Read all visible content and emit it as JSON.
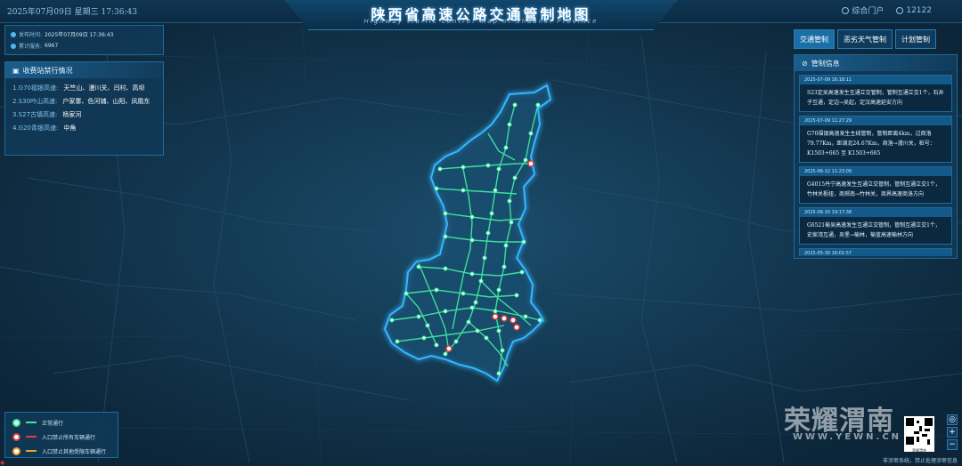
{
  "header": {
    "date": "2025年07月09日 星期三   17:36:43",
    "title": "陕西省高速公路交通管制地图",
    "subtitle": "Highway traffic control map of Shaanxi Province",
    "portal": "综合门户",
    "hotline": "12122"
  },
  "info": {
    "publish_label": "发布时间:",
    "publish_value": "2025年07月09日  17:36:43",
    "service_label": "累计服务:",
    "service_value": "6967"
  },
  "toll": {
    "title": "收费站禁行情况",
    "items": [
      {
        "road": "1.G70福银高速:",
        "value": "天竺山、漫川关、闫村、高坝"
      },
      {
        "road": "2.S30吟山高速:",
        "value": "户家寨、色河铺、山阳、凤凰东"
      },
      {
        "road": "3.S27古镇高速:",
        "value": "杨家河"
      },
      {
        "road": "4.G20青银高速:",
        "value": "中角"
      }
    ]
  },
  "tabs": [
    "交通管制",
    "恶劣天气管制",
    "计划管制"
  ],
  "control": {
    "title": "管制信息",
    "items": [
      {
        "time": "2025-07-09 16:18:11",
        "text": "S23定吴高速发生互通立交管制，管制互通立交1个，石井子互通，定边→吴起，定汉高速延安方向"
      },
      {
        "time": "2025-07-09 11:27:29",
        "text": "G70福银高速发生主线管制，管制距离4km，过商洛79.77Km，距湖北24.67Km，商洛→漫川关，桩号：K1503+665 至 K1503+665"
      },
      {
        "time": "2025-06-12 11:23:09",
        "text": "G4015丹宁高速发生互通立交管制，管制互通立交1个，竹林关枢纽，商郏南→竹林关，商界高速商洛方向"
      },
      {
        "time": "2025-06-10 19:17:38",
        "text": "G6521榆吴高速发生互通立交管制，管制互通立交1个，史家湾互通，吴堡→榆林，榆蓝高速榆林方向"
      },
      {
        "time": "2025-05-30 16:01:57",
        "text": ""
      }
    ]
  },
  "legend": [
    {
      "label": "正常通行",
      "color": "#3ee6a0",
      "icon": "normal-node-icon"
    },
    {
      "label": "入口禁止所有车辆通行",
      "color": "#e2403a",
      "icon": "no-entry-all-icon"
    },
    {
      "label": "入口禁止其他受限车辆通行",
      "color": "#f0a030",
      "icon": "no-entry-restricted-icon"
    }
  ],
  "watermark": {
    "brand": "荣耀渭南",
    "site": "WWW.YEWN.CN",
    "qr_label": "荣耀渭南"
  },
  "footer": "非涉密系统，禁止处理涉密信息"
}
